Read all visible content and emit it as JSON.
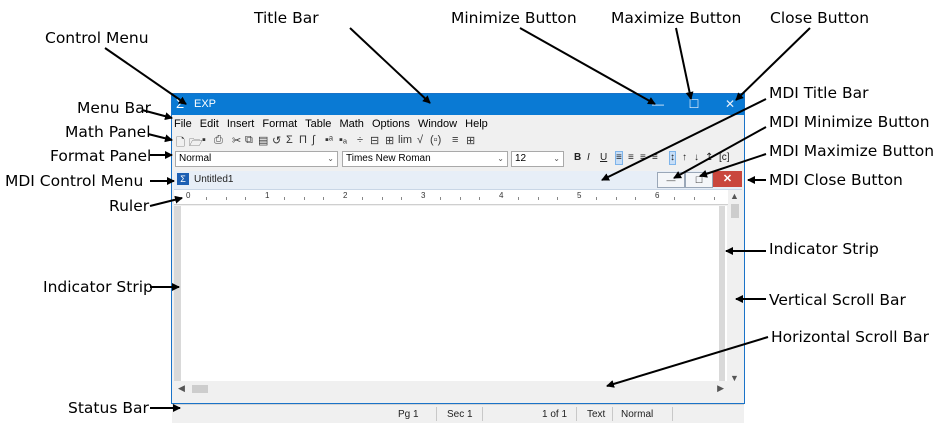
{
  "callouts": {
    "title_bar": "Title Bar",
    "minimize_button": "Minimize Button",
    "maximize_button": "Maximize Button",
    "close_button": "Close Button",
    "control_menu": "Control Menu",
    "menu_bar": "Menu Bar",
    "math_panel": "Math Panel",
    "format_panel": "Format Panel",
    "mdi_control_menu": "MDI Control Menu",
    "ruler": "Ruler",
    "indicator_strip_left": "Indicator Strip",
    "status_bar": "Status Bar",
    "mdi_title_bar": "MDI Title Bar",
    "mdi_minimize_button": "MDI Minimize Button",
    "mdi_maximize_button": "MDI Maximize Button",
    "mdi_close_button": "MDI Close Button",
    "indicator_strip_right": "Indicator Strip",
    "vertical_scroll_bar": "Vertical Scroll Bar",
    "horizontal_scroll_bar": "Horizontal Scroll Bar"
  },
  "window": {
    "title": "EXP",
    "logo_glyph": "Σ",
    "minimize_glyph": "—",
    "maximize_glyph": "☐",
    "close_glyph": "✕",
    "accent_color": "#0a7ad4"
  },
  "menu": {
    "items": [
      "File",
      "Edit",
      "Insert",
      "Format",
      "Table",
      "Math",
      "Options",
      "Window",
      "Help"
    ]
  },
  "math_panel": {
    "icons": [
      "new-doc-icon",
      "open-icon",
      "save-icon",
      "print-icon",
      "cut-icon",
      "copy-icon",
      "paste-icon",
      "undo-icon",
      "sum-icon",
      "product-icon",
      "integral-icon",
      "superscript-icon",
      "subscript-icon",
      "fraction-icon",
      "divide-icon",
      "matrix-icon",
      "limit-icon",
      "sqrt-icon",
      "brackets-icon",
      "stacked-icon",
      "table-icon"
    ]
  },
  "format": {
    "style_value": "Normal",
    "font_value": "Times New Roman",
    "size_value": "12",
    "bold": "B",
    "italic": "I",
    "underline": "U",
    "tag": "[c]"
  },
  "mdi": {
    "title": "Untitled1",
    "minimize_glyph": "—",
    "maximize_glyph": "☐",
    "close_glyph": "✕",
    "close_color": "#c9463d"
  },
  "ruler": {
    "numbers": [
      "0",
      "1",
      "2",
      "3",
      "4",
      "5",
      "6"
    ]
  },
  "status": {
    "page": "Pg 1",
    "section": "Sec 1",
    "of": "1 of 1",
    "mode": "Text",
    "style": "Normal"
  }
}
